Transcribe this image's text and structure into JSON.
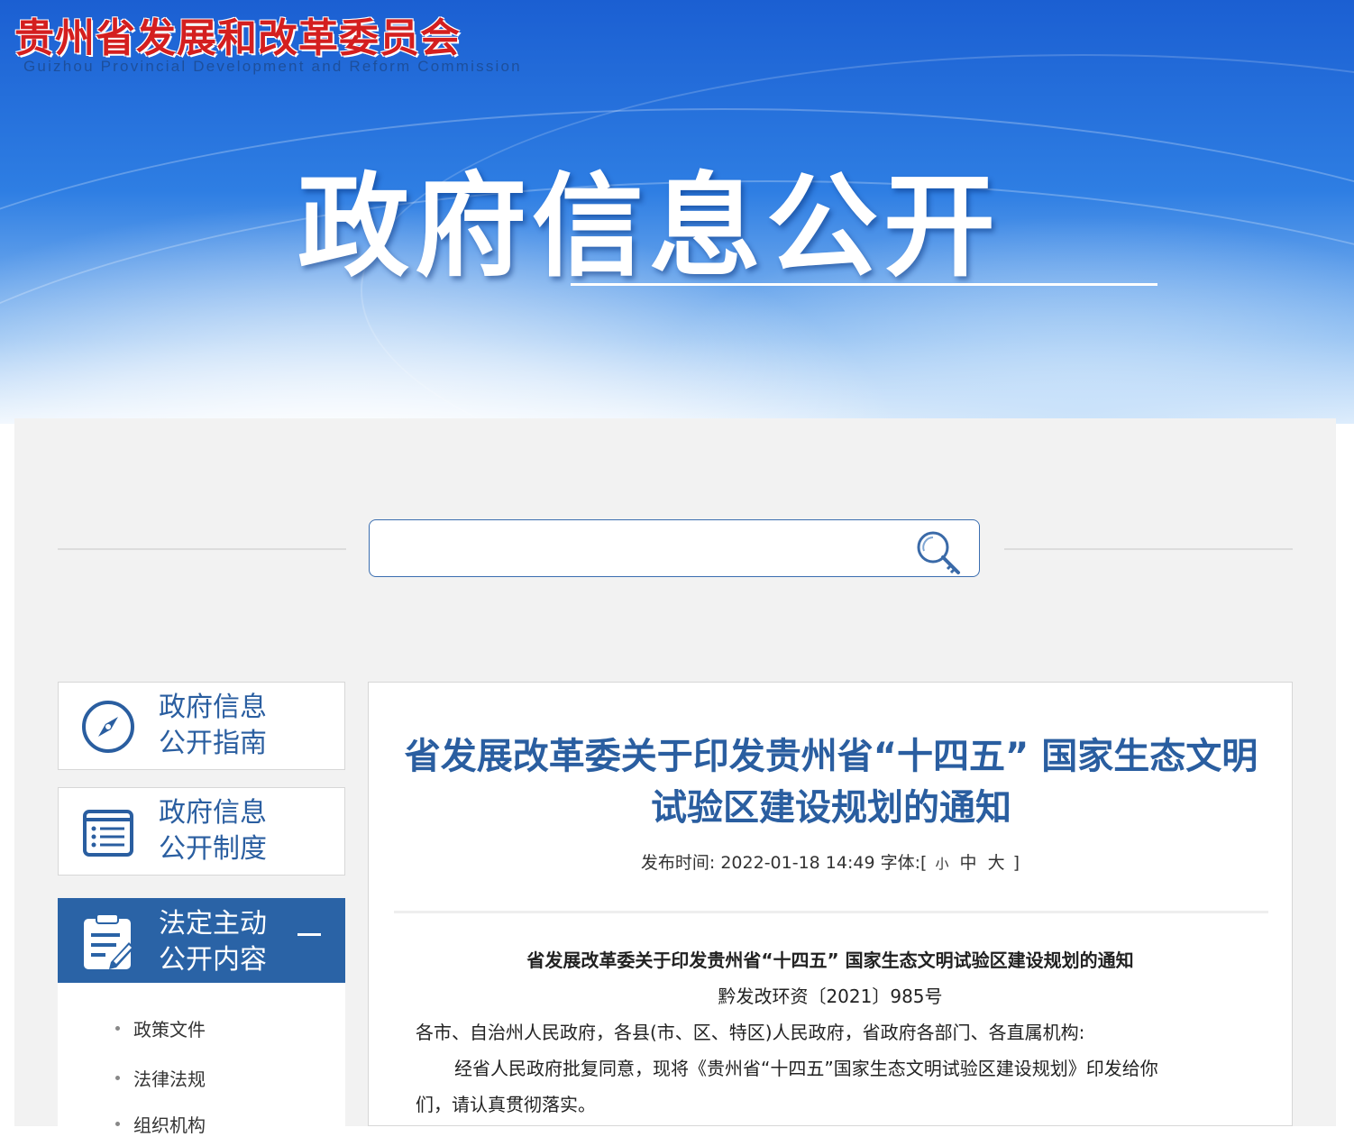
{
  "header": {
    "org_name_cn": "贵州省发展和改革委员会",
    "org_name_en": "Guizhou Provincial Development and Reform Commission",
    "banner_title": "政府信息公开"
  },
  "search": {
    "value": "",
    "icon": "search-key-icon"
  },
  "sidebar": {
    "items": [
      {
        "label_line1": "政府信息",
        "label_line2": "公开指南",
        "icon": "compass-icon",
        "active": false
      },
      {
        "label_line1": "政府信息",
        "label_line2": "公开制度",
        "icon": "list-document-icon",
        "active": false
      },
      {
        "label_line1": "法定主动",
        "label_line2": "公开内容",
        "icon": "clipboard-edit-icon",
        "active": true,
        "toggle_icon": "collapse-minus-icon"
      }
    ],
    "subitems": [
      "政策文件",
      "法律法规",
      "组织机构"
    ]
  },
  "article": {
    "title": "省发展改革委关于印发贵州省“十四五” 国家生态文明试验区建设规划的通知",
    "meta_prefix": "发布时间: 2022-01-18 14:49 字体:[",
    "font_small": "小",
    "font_medium": "中",
    "font_large": "大",
    "meta_suffix": "]",
    "body_title": "省发展改革委关于印发贵州省“十四五” 国家生态文明试验区建设规划的通知",
    "doc_number": "黔发改环资〔2021〕985号",
    "recipients": "各市、自治州人民政府，各县(市、区、特区)人民政府，省政府各部门、各直属机构:",
    "para1_line1": "经省人民政府批复同意，现将《贵州省“十四五”国家生态文明试验区建设规划》印发给你",
    "para1_line2": "们，请认真贯彻落实。"
  },
  "colors": {
    "accent_blue": "#2a5ea0",
    "active_nav_bg": "#2a63a6",
    "org_red": "#d41f1f"
  }
}
